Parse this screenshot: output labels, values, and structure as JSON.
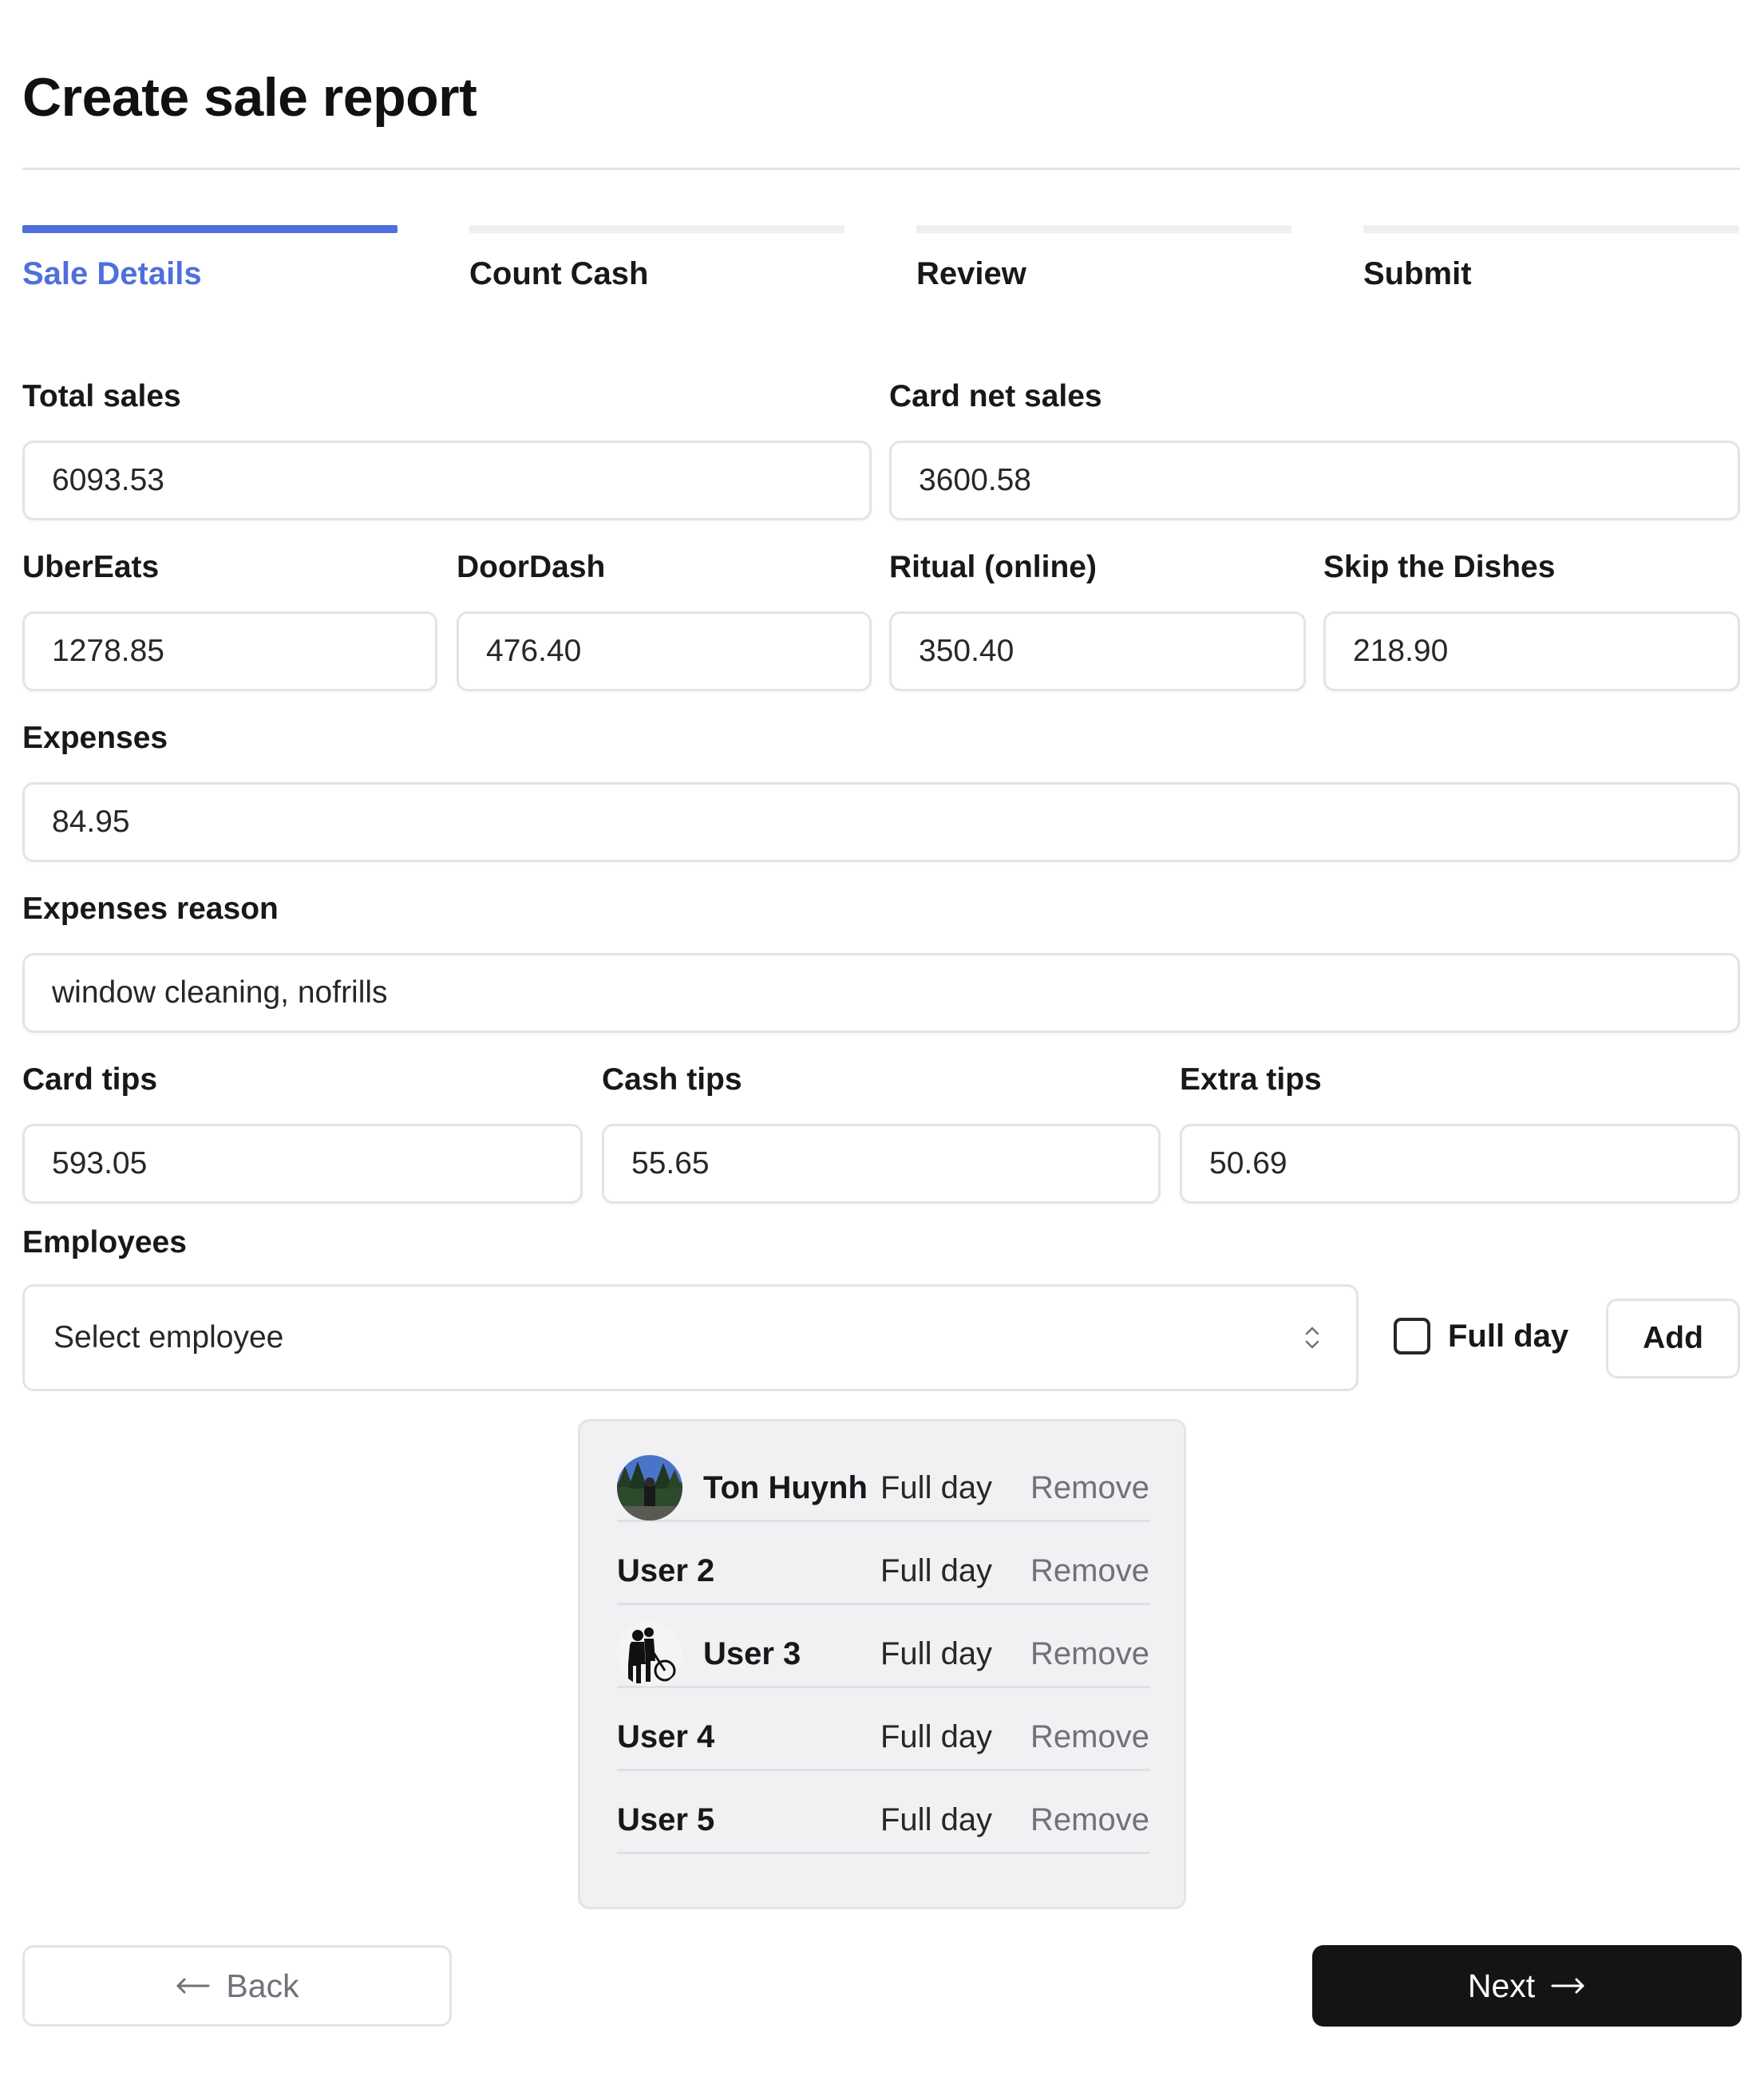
{
  "page": {
    "title": "Create sale report"
  },
  "steps": [
    {
      "label": "Sale Details",
      "active": true
    },
    {
      "label": "Count Cash",
      "active": false
    },
    {
      "label": "Review",
      "active": false
    },
    {
      "label": "Submit",
      "active": false
    }
  ],
  "form": {
    "total_sales": {
      "label": "Total sales",
      "value": "6093.53"
    },
    "card_net_sales": {
      "label": "Card net sales",
      "value": "3600.58"
    },
    "ubereats": {
      "label": "UberEats",
      "value": "1278.85"
    },
    "doordash": {
      "label": "DoorDash",
      "value": "476.40"
    },
    "ritual": {
      "label": "Ritual (online)",
      "value": "350.40"
    },
    "skip": {
      "label": "Skip the Dishes",
      "value": "218.90"
    },
    "expenses": {
      "label": "Expenses",
      "value": "84.95"
    },
    "expenses_reason": {
      "label": "Expenses reason",
      "value": "window cleaning, nofrills"
    },
    "card_tips": {
      "label": "Card tips",
      "value": "593.05"
    },
    "cash_tips": {
      "label": "Cash tips",
      "value": "55.65"
    },
    "extra_tips": {
      "label": "Extra tips",
      "value": "50.69"
    }
  },
  "employees": {
    "label": "Employees",
    "select_placeholder": "Select employee",
    "full_day_label": "Full day",
    "full_day_checked": false,
    "add_label": "Add",
    "list": [
      {
        "name": "Ton Huynh",
        "type": "Full day",
        "remove": "Remove",
        "avatar": "landscape-photo"
      },
      {
        "name": "User 2",
        "type": "Full day",
        "remove": "Remove",
        "avatar": ""
      },
      {
        "name": "User 3",
        "type": "Full day",
        "remove": "Remove",
        "avatar": "silhouette-photo"
      },
      {
        "name": "User 4",
        "type": "Full day",
        "remove": "Remove",
        "avatar": ""
      },
      {
        "name": "User 5",
        "type": "Full day",
        "remove": "Remove",
        "avatar": ""
      }
    ]
  },
  "nav": {
    "back_label": "Back",
    "back_icon": "arrow-left-icon",
    "next_label": "Next",
    "next_icon": "arrow-right-icon"
  },
  "colors": {
    "accent": "#4f6fdc",
    "primary_button": "#141416",
    "border": "#e4e4e7",
    "muted_text": "#71717a"
  }
}
